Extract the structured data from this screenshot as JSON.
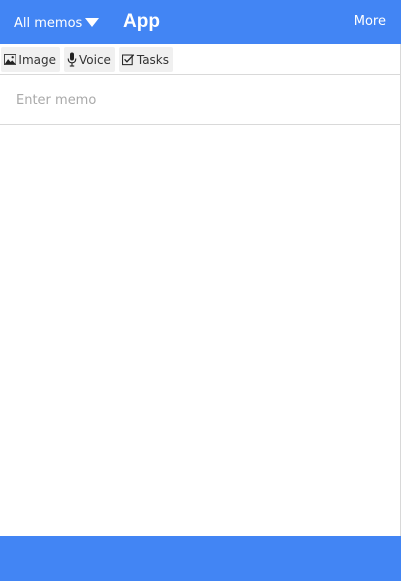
{
  "header": {
    "filter_label": "All memos",
    "title": "App",
    "more_label": "More"
  },
  "toolbar": {
    "image_label": "Image",
    "voice_label": "Voice",
    "tasks_label": "Tasks"
  },
  "memo": {
    "placeholder": "Enter memo",
    "value": ""
  },
  "colors": {
    "accent": "#4285f4",
    "tool_bg": "#f0f0f0"
  },
  "icons": {
    "image": "image-icon",
    "voice": "microphone-icon",
    "tasks": "checkbox-icon",
    "filter": "caret-down-icon"
  }
}
